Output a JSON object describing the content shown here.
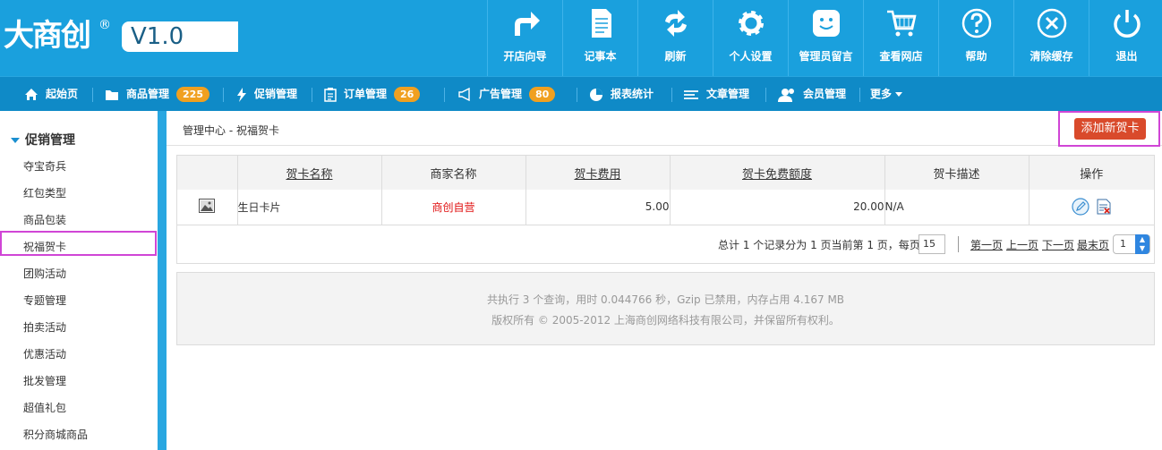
{
  "logo": {
    "text": "大商创",
    "reg": "®",
    "version": "V1.0"
  },
  "tools": [
    {
      "label": "开店向导",
      "icon": "share-arrow-icon"
    },
    {
      "label": "记事本",
      "icon": "notepad-icon"
    },
    {
      "label": "刷新",
      "icon": "refresh-icon"
    },
    {
      "label": "个人设置",
      "icon": "gear-icon"
    },
    {
      "label": "管理员留言",
      "icon": "message-smile-icon"
    },
    {
      "label": "查看网店",
      "icon": "cart-icon"
    },
    {
      "label": "帮助",
      "icon": "help-icon"
    },
    {
      "label": "清除缓存",
      "icon": "clear-cache-icon"
    },
    {
      "label": "退出",
      "icon": "power-icon"
    }
  ],
  "nav": {
    "home": "起始页",
    "goods": "商品管理",
    "goods_badge": "225",
    "promo": "促销管理",
    "orders": "订单管理",
    "orders_badge": "26",
    "ads": "广告管理",
    "ads_badge": "80",
    "reports": "报表统计",
    "articles": "文章管理",
    "members": "会员管理",
    "more": "更多"
  },
  "sidebar": {
    "heading": "促销管理",
    "items": [
      "夺宝奇兵",
      "红包类型",
      "商品包装",
      "祝福贺卡",
      "团购活动",
      "专题管理",
      "拍卖活动",
      "优惠活动",
      "批发管理",
      "超值礼包",
      "积分商城商品"
    ]
  },
  "breadcrumb": {
    "root": "管理中心",
    "sep": " - ",
    "current": "祝福贺卡"
  },
  "add_button": "添加新贺卡",
  "table": {
    "headers": [
      "贺卡名称",
      "商家名称",
      "贺卡费用",
      "贺卡免费额度",
      "贺卡描述",
      "操作"
    ],
    "rows": [
      {
        "name": "生日卡片",
        "shop": "商创自营",
        "fee": "5.00",
        "free": "20.00",
        "desc": "N/A"
      }
    ]
  },
  "pager": {
    "summary": "总计 1 个记录分为 1 页当前第 1 页，每页",
    "per_page": "15",
    "first": "第一页",
    "prev": "上一页",
    "next": "下一页",
    "last": "最末页",
    "page": "1"
  },
  "footer": {
    "line1": "共执行 3 个查询，用时 0.044766 秒，Gzip 已禁用，内存占用 4.167 MB",
    "line2": "版权所有 © 2005-2012 上海商创网络科技有限公司，并保留所有权利。"
  },
  "colors": {
    "header": "#1aa0dd",
    "nav": "#0f8ac7",
    "badge": "#f0a020",
    "accent": "#d94a2b",
    "highlight": "#d045d6"
  }
}
